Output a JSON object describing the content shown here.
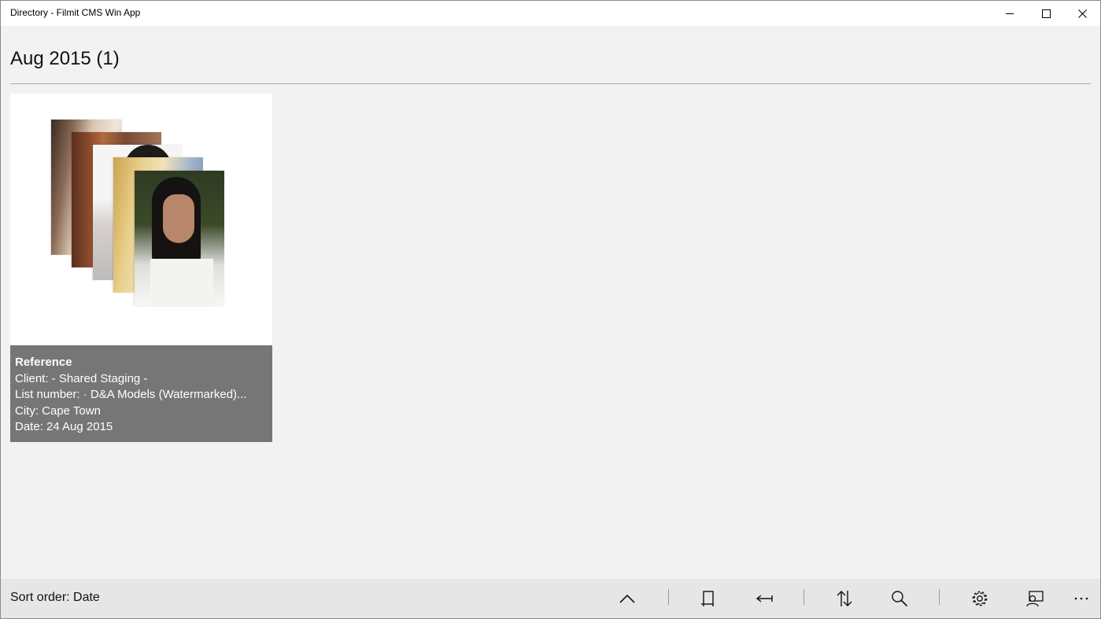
{
  "window": {
    "title": "Directory - Filmit CMS Win App",
    "controls": [
      "minimize-icon",
      "maximize-icon",
      "close-icon"
    ]
  },
  "header": {
    "title": "Aug 2015 (1)"
  },
  "cards": [
    {
      "name": "Reference",
      "client": "Client: - Shared Staging -",
      "list_number": "List number:  · D&A Models (Watermarked)...",
      "city": "City: Cape Town",
      "date": "Date: 24 Aug 2015",
      "thumbnail_count": 5
    }
  ],
  "commandbar": {
    "sort_label": "Sort order: Date",
    "buttons": [
      "chevron-up-icon",
      "crop-icon",
      "back-to-start-icon",
      "sort-icon",
      "search-icon",
      "settings-icon",
      "contact-icon",
      "more-icon"
    ]
  },
  "colors": {
    "background": "#f2f2f2",
    "card_info_bg": "#767676",
    "commandbar_bg": "#e6e6e6"
  }
}
